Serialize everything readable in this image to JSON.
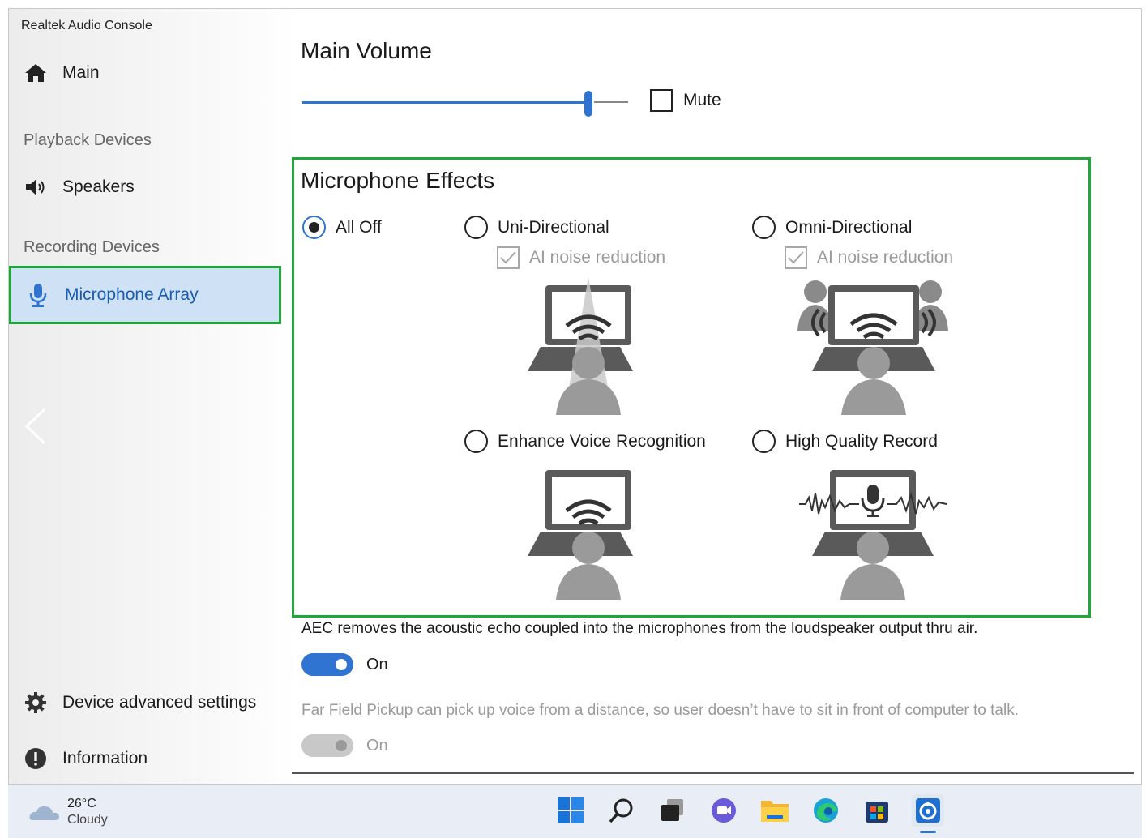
{
  "app": {
    "title": "Realtek Audio Console"
  },
  "sidebar": {
    "main_label": "Main",
    "playback_section": "Playback Devices",
    "speakers_label": "Speakers",
    "recording_section": "Recording Devices",
    "microphone_label": "Microphone Array",
    "advanced_label": "Device advanced settings",
    "information_label": "Information"
  },
  "main_volume": {
    "title": "Main Volume",
    "level": 0.87,
    "mute_label": "Mute",
    "mute_checked": false
  },
  "microphone_effects": {
    "title": "Microphone Effects",
    "selected": "All Off",
    "options": {
      "all_off": "All Off",
      "uni": "Uni-Directional",
      "omni": "Omni-Directional",
      "evr": "Enhance Voice Recognition",
      "hqr": "High Quality Record"
    },
    "ai_noise_reduction_label": "AI noise reduction",
    "ai_noise_uni_checked": true,
    "ai_noise_omni_checked": true
  },
  "aec": {
    "description": "AEC removes the acoustic echo coupled into the microphones from the loudspeaker output thru air.",
    "toggle_label": "On",
    "enabled": true
  },
  "far_field": {
    "description": "Far Field Pickup can pick up voice from a distance, so user doesn’t have to sit in front of computer to talk.",
    "toggle_label": "On",
    "enabled": true,
    "disabled_state": true
  },
  "taskbar": {
    "weather_temp": "26°C",
    "weather_condition": "Cloudy",
    "icons": [
      "windows-start-icon",
      "search-icon",
      "task-view-icon",
      "chat-icon",
      "file-explorer-icon",
      "edge-icon",
      "store-icon",
      "realtek-audio-icon"
    ]
  },
  "colors": {
    "accent": "#2f74d0",
    "highlight_border": "#1fa83a",
    "selected_nav_bg": "#cfe1f5"
  }
}
